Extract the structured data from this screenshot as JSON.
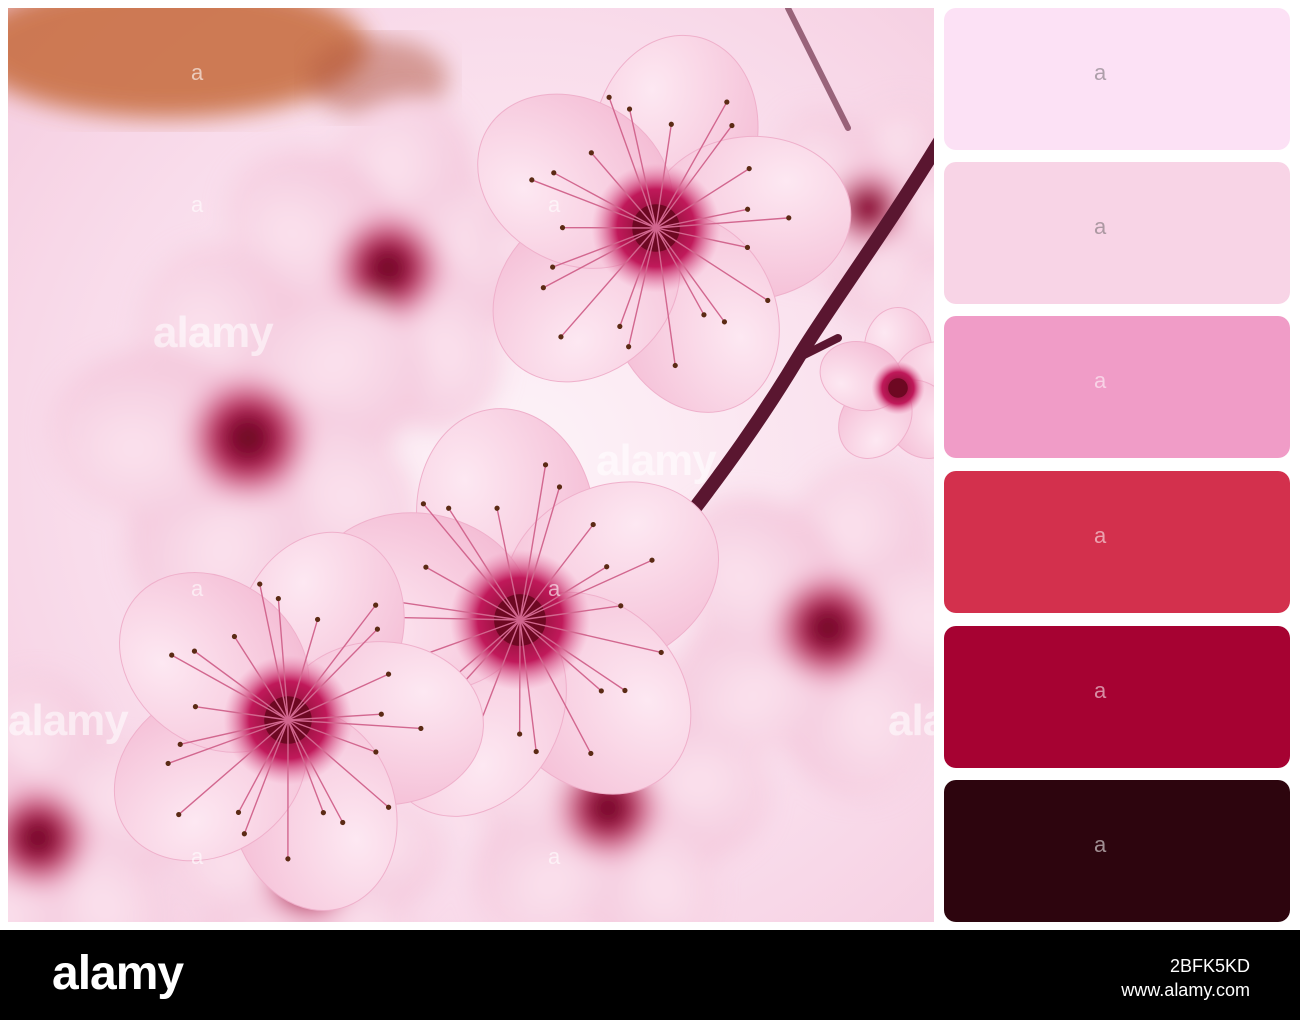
{
  "photo": {
    "watermark_text": "alamy",
    "watermark_glyph": "a"
  },
  "palette": {
    "swatches": [
      {
        "name": "pale-pink",
        "color": "#fce1f5"
      },
      {
        "name": "light-pink",
        "color": "#f8d4e6"
      },
      {
        "name": "medium-pink",
        "color": "#f09cc7"
      },
      {
        "name": "crimson",
        "color": "#d3304d"
      },
      {
        "name": "dark-red",
        "color": "#a60232"
      },
      {
        "name": "deep-maroon",
        "color": "#2d050e"
      }
    ],
    "watermark_glyph": "a"
  },
  "footer": {
    "logo": "alamy",
    "image_id": "2BFK5KD",
    "url": "www.alamy.com"
  }
}
